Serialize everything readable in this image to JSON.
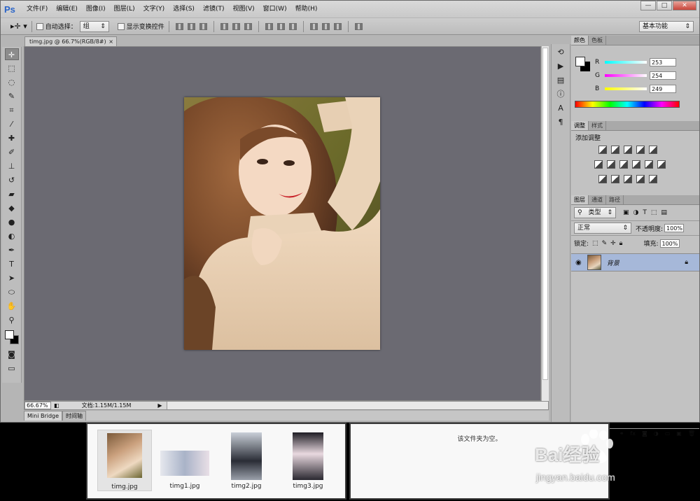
{
  "app": {
    "logo": "Ps"
  },
  "menu": [
    "文件(F)",
    "编辑(E)",
    "图像(I)",
    "图层(L)",
    "文字(Y)",
    "选择(S)",
    "滤镜(T)",
    "视图(V)",
    "窗口(W)",
    "帮助(H)"
  ],
  "window_controls": {
    "minimize": "—",
    "restore": "□",
    "close": "✕"
  },
  "options": {
    "auto_select_label": "自动选择：",
    "auto_select_value": "组",
    "show_transform_label": "显示变换控件",
    "workspace": "基本功能"
  },
  "document": {
    "tab_title": "timg.jpg @ 66.7%(RGB/8#)",
    "zoom": "66.67%",
    "status": "文档:1.15M/1.15M"
  },
  "bottom_tabs": [
    "Mini Bridge",
    "时间轴"
  ],
  "color_panel": {
    "tabs": [
      "颜色",
      "色板"
    ],
    "r": {
      "label": "R",
      "value": "253"
    },
    "g": {
      "label": "G",
      "value": "254"
    },
    "b": {
      "label": "B",
      "value": "249"
    }
  },
  "adjust_panel": {
    "tabs": [
      "调整",
      "样式"
    ],
    "title": "添加调整"
  },
  "layers_panel": {
    "tabs": [
      "图层",
      "通道",
      "路径"
    ],
    "filter": "类型",
    "blend_mode": "正常",
    "opacity_label": "不透明度:",
    "opacity_value": "100%",
    "lock_label": "锁定:",
    "fill_label": "填充:",
    "fill_value": "100%",
    "layer_name": "背景"
  },
  "bridge": {
    "files": [
      "timg.jpg",
      "timg1.jpg",
      "timg2.jpg",
      "timg3.jpg"
    ],
    "empty_text": "该文件夹为空。"
  },
  "watermark": {
    "brand": "Bai经验",
    "url": "jingyan.baidu.com"
  },
  "colors": {
    "accent_ps": "#2a64c8",
    "canvas_bg": "#6b6a72",
    "layer_selected": "#a6b8d9"
  }
}
